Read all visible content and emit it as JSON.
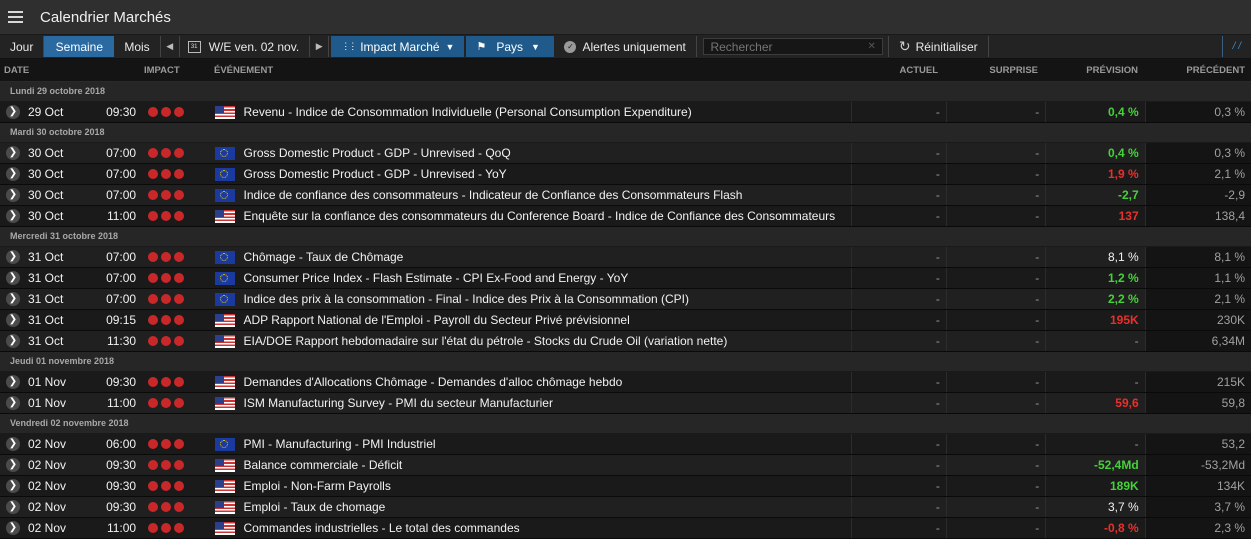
{
  "title": "Calendrier Marchés",
  "toolbar": {
    "jour": "Jour",
    "semaine": "Semaine",
    "mois": "Mois",
    "calendar_day": "31",
    "week_label": "W/E ven. 02 nov.",
    "impact": "Impact Marché",
    "pays": "Pays",
    "alertes": "Alertes uniquement",
    "search_placeholder": "Rechercher",
    "reset": "Réinitialiser",
    "corner": "/ /"
  },
  "columns": {
    "date": "DATE",
    "impact": "IMPACT",
    "event": "ÉVÉNEMENT",
    "actuel": "ACTUEL",
    "surprise": "SURPRISE",
    "prevision": "PRÉVISION",
    "precedent": "PRÉCÉDENT"
  },
  "groups": [
    {
      "label": "Lundi 29 octobre 2018",
      "rows": [
        {
          "date": "29 Oct",
          "time": "09:30",
          "flag": "us",
          "event": "Revenu - Indice de Consommation Individuelle (Personal Consumption Expenditure)",
          "actuel": "-",
          "surprise": "-",
          "prevision": "0,4 %",
          "prevision_color": "green",
          "precedent": "0,3 %"
        }
      ]
    },
    {
      "label": "Mardi 30 octobre 2018",
      "rows": [
        {
          "date": "30 Oct",
          "time": "07:00",
          "flag": "eu",
          "event": "Gross Domestic Product - GDP - Unrevised - QoQ",
          "actuel": "-",
          "surprise": "-",
          "prevision": "0,4 %",
          "prevision_color": "green",
          "precedent": "0,3 %"
        },
        {
          "date": "30 Oct",
          "time": "07:00",
          "flag": "eu",
          "event": "Gross Domestic Product - GDP - Unrevised - YoY",
          "actuel": "-",
          "surprise": "-",
          "prevision": "1,9 %",
          "prevision_color": "red",
          "precedent": "2,1 %"
        },
        {
          "date": "30 Oct",
          "time": "07:00",
          "flag": "eu",
          "event": "Indice de confiance des consommateurs - Indicateur de Confiance des Consommateurs Flash",
          "actuel": "-",
          "surprise": "-",
          "prevision": "-2,7",
          "prevision_color": "green",
          "precedent": "-2,9"
        },
        {
          "date": "30 Oct",
          "time": "11:00",
          "flag": "us",
          "event": "Enquête sur la confiance des consommateurs du Conference Board - Indice de Confiance des Consommateurs",
          "actuel": "-",
          "surprise": "-",
          "prevision": "137",
          "prevision_color": "red",
          "precedent": "138,4"
        }
      ]
    },
    {
      "label": "Mercredi 31 octobre 2018",
      "rows": [
        {
          "date": "31 Oct",
          "time": "07:00",
          "flag": "eu",
          "event": "Chômage - Taux de Chômage",
          "actuel": "-",
          "surprise": "-",
          "prevision": "8,1 %",
          "prevision_color": "white",
          "precedent": "8,1 %"
        },
        {
          "date": "31 Oct",
          "time": "07:00",
          "flag": "eu",
          "event": "Consumer Price Index - Flash Estimate - CPI Ex-Food and Energy - YoY",
          "actuel": "-",
          "surprise": "-",
          "prevision": "1,2 %",
          "prevision_color": "green",
          "precedent": "1,1 %"
        },
        {
          "date": "31 Oct",
          "time": "07:00",
          "flag": "eu",
          "event": "Indice des prix à la consommation - Final - Indice des Prix à la Consommation (CPI)",
          "actuel": "-",
          "surprise": "-",
          "prevision": "2,2 %",
          "prevision_color": "green",
          "precedent": "2,1 %"
        },
        {
          "date": "31 Oct",
          "time": "09:15",
          "flag": "us",
          "event": "ADP Rapport National de l'Emploi - Payroll du Secteur Privé prévisionnel",
          "actuel": "-",
          "surprise": "-",
          "prevision": "195K",
          "prevision_color": "red",
          "precedent": "230K"
        },
        {
          "date": "31 Oct",
          "time": "11:30",
          "flag": "us",
          "event": "EIA/DOE Rapport hebdomadaire sur l'état du pétrole - Stocks du Crude Oil (variation nette)",
          "actuel": "-",
          "surprise": "-",
          "prevision": "-",
          "prevision_color": "dash",
          "precedent": "6,34M"
        }
      ]
    },
    {
      "label": "Jeudi 01 novembre 2018",
      "rows": [
        {
          "date": "01 Nov",
          "time": "09:30",
          "flag": "us",
          "event": "Demandes d'Allocations Chômage - Demandes d'alloc chômage hebdo",
          "actuel": "-",
          "surprise": "-",
          "prevision": "-",
          "prevision_color": "dash",
          "precedent": "215K"
        },
        {
          "date": "01 Nov",
          "time": "11:00",
          "flag": "us",
          "event": "ISM Manufacturing Survey - PMI du secteur Manufacturier",
          "actuel": "-",
          "surprise": "-",
          "prevision": "59,6",
          "prevision_color": "red",
          "precedent": "59,8"
        }
      ]
    },
    {
      "label": "Vendredi 02 novembre 2018",
      "rows": [
        {
          "date": "02 Nov",
          "time": "06:00",
          "flag": "eu",
          "event": "PMI - Manufacturing - PMI Industriel",
          "actuel": "-",
          "surprise": "-",
          "prevision": "-",
          "prevision_color": "dash",
          "precedent": "53,2"
        },
        {
          "date": "02 Nov",
          "time": "09:30",
          "flag": "us",
          "event": "Balance commerciale - Déficit",
          "actuel": "-",
          "surprise": "-",
          "prevision": "-52,4Md",
          "prevision_color": "green",
          "precedent": "-53,2Md"
        },
        {
          "date": "02 Nov",
          "time": "09:30",
          "flag": "us",
          "event": "Emploi - Non-Farm Payrolls",
          "actuel": "-",
          "surprise": "-",
          "prevision": "189K",
          "prevision_color": "green",
          "precedent": "134K"
        },
        {
          "date": "02 Nov",
          "time": "09:30",
          "flag": "us",
          "event": "Emploi - Taux de chomage",
          "actuel": "-",
          "surprise": "-",
          "prevision": "3,7 %",
          "prevision_color": "white",
          "precedent": "3,7 %"
        },
        {
          "date": "02 Nov",
          "time": "11:00",
          "flag": "us",
          "event": "Commandes industrielles - Le total des commandes",
          "actuel": "-",
          "surprise": "-",
          "prevision": "-0,8 %",
          "prevision_color": "red",
          "precedent": "2,3 %"
        }
      ]
    }
  ],
  "colors": {
    "accent": "#2a6aa0",
    "positive": "#46d13a",
    "negative": "#e8302c",
    "impact": "#c9282a"
  },
  "icons": {
    "menu": "hamburger-icon",
    "row": "chevron-right-icon",
    "calendar": "calendar-icon",
    "impact": "dots-grid-icon",
    "country": "flag-icon",
    "alert": "check-circle-icon",
    "clear": "close-icon",
    "reset": "refresh-icon"
  }
}
